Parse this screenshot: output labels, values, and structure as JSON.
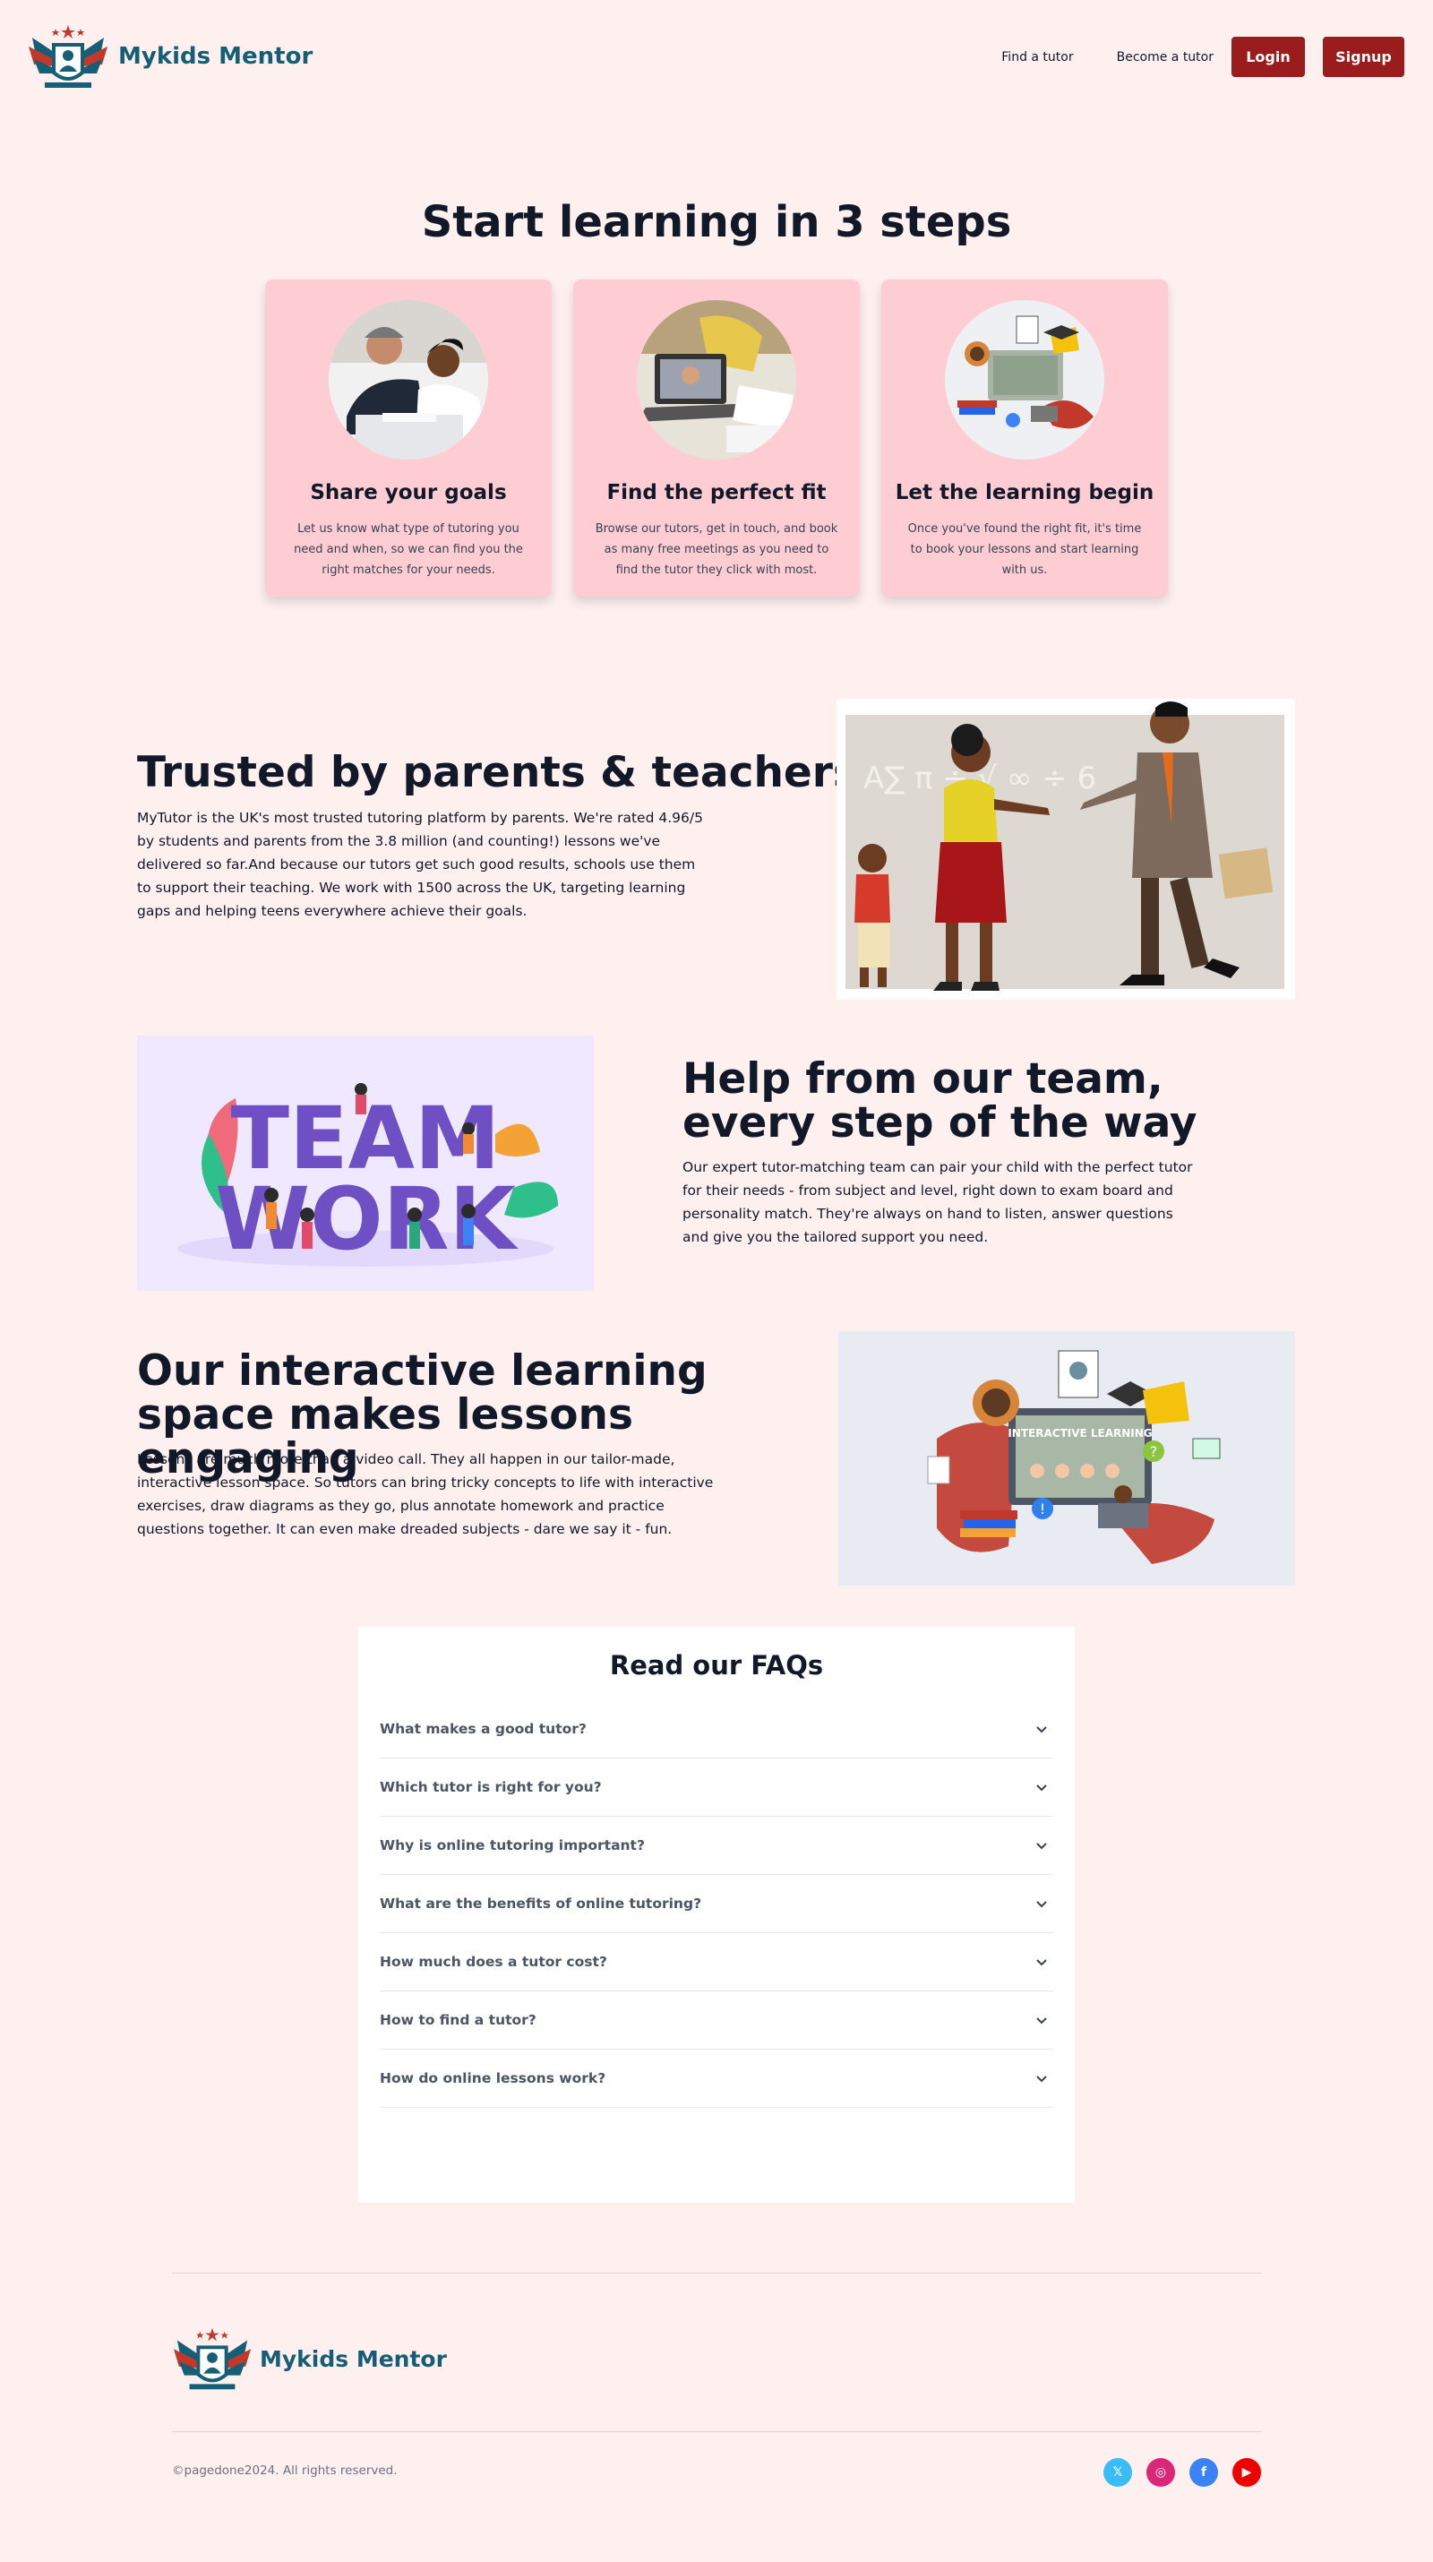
{
  "header": {
    "brand": "Mykids Mentor",
    "nav": {
      "find_tutor": "Find a tutor",
      "become_tutor": "Become a tutor",
      "login": "Login",
      "signup": "Signup"
    }
  },
  "steps": {
    "title": "Start learning in 3 steps",
    "cards": [
      {
        "title": "Share your goals",
        "desc": "Let us know what type of tutoring you need and when, so we can find you the right matches for your needs."
      },
      {
        "title": "Find the perfect fit",
        "desc": "Browse our tutors, get in touch, and book as many free meetings as you need to find the tutor they click with most."
      },
      {
        "title": "Let the learning begin",
        "desc": "Once you've found the right fit, it's time to book your lessons and start learning with us."
      }
    ]
  },
  "trusted": {
    "title": "Trusted by parents & teachers",
    "text": "MyTutor is the UK's most trusted tutoring platform by parents. We're rated 4.96/5 by students and parents from the 3.8 million (and counting!) lessons we've delivered so far.And because our tutors get such good results, schools use them to support their teaching. We work with 1500 across the UK, targeting learning gaps and helping teens everywhere achieve their goals."
  },
  "team": {
    "title": "Help from our team, every step of the way",
    "text": "Our expert tutor-matching team can pair your child with the perfect tutor for their needs - from subject and level, right down to exam board and personality match. They're always on hand to listen, answer questions and give you the tailored support you need.",
    "image_word1": "TEAM",
    "image_word2": "WORK"
  },
  "interactive": {
    "title": "Our interactive learning space makes lessons engaging",
    "text": "Lessons are much more than a video call. They all happen in our tailor-made, interactive lesson space. So tutors can bring tricky concepts to life with interactive exercises, draw diagrams as they go, plus annotate homework and practice questions together. It can even make dreaded subjects - dare we say it - fun.",
    "image_label": "INTERACTIVE LEARNING"
  },
  "faq": {
    "title": "Read our FAQs",
    "items": [
      "What makes a good tutor?",
      "Which tutor is right for you?",
      "Why is online tutoring important?",
      "What are the benefits of online tutoring?",
      "How much does a tutor cost?",
      "How to find a tutor?",
      "How do online lessons work?"
    ]
  },
  "footer": {
    "brand": "Mykids Mentor",
    "copyright": "©pagedone2024. All rights reserved.",
    "socials": [
      {
        "name": "x-icon",
        "glyph": "𝕏",
        "color": "#38bdf8"
      },
      {
        "name": "instagram-icon",
        "glyph": "◎",
        "color": "#db2777"
      },
      {
        "name": "facebook-icon",
        "glyph": "f",
        "color": "#3b82f6"
      },
      {
        "name": "youtube-icon",
        "glyph": "▶",
        "color": "#ef0000"
      }
    ]
  },
  "colors": {
    "accent": "#9b1c1c",
    "brand_text": "#155e75",
    "card_bg": "#fecdd3",
    "page_bg": "#fff0f0"
  }
}
